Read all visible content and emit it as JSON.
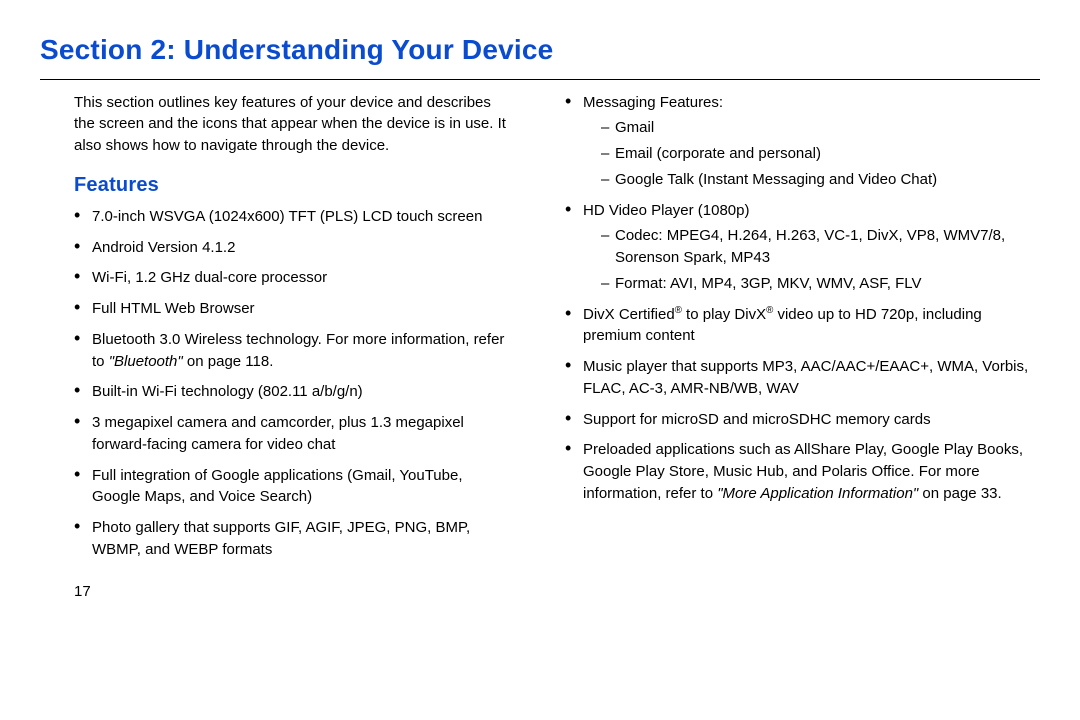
{
  "section_title": "Section 2: Understanding Your Device",
  "intro": "This section outlines key features of your device and describes the screen and the icons that appear when the device is in use. It also shows how to navigate through the device.",
  "features_heading": "Features",
  "left_bullets": {
    "b1": "7.0-inch WSVGA (1024x600) TFT (PLS) LCD touch screen",
    "b2": "Android Version 4.1.2",
    "b3": "Wi-Fi, 1.2 GHz dual-core processor",
    "b4": "Full HTML Web Browser",
    "b5_pre": "Bluetooth 3.0 Wireless technology. For more information, refer to ",
    "b5_link": "\"Bluetooth\"",
    "b5_post": " on page 118.",
    "b6": "Built-in Wi-Fi technology (802.11 a/b/g/n)",
    "b7": "3 megapixel camera and camcorder, plus 1.3 megapixel forward-facing camera for video chat",
    "b8": "Full integration of Google applications (Gmail, YouTube, Google Maps, and Voice Search)",
    "b9": "Photo gallery that supports GIF, AGIF, JPEG, PNG, BMP, WBMP, and WEBP formats"
  },
  "right_bullets": {
    "msg_title": "Messaging Features:",
    "msg_items": {
      "m1": "Gmail",
      "m2": "Email (corporate and personal)",
      "m3": "Google Talk (Instant Messaging and Video Chat)"
    },
    "hd_title": "HD Video Player (1080p)",
    "hd_items": {
      "h1": "Codec: MPEG4, H.264, H.263, VC-1, DivX, VP8, WMV7/8, Sorenson Spark, MP43",
      "h2": "Format: AVI, MP4, 3GP, MKV, WMV, ASF, FLV"
    },
    "divx_pre": "DivX Certified",
    "divx_mid": " to play DivX",
    "divx_post": " video up to HD 720p, including premium content",
    "reg": "®",
    "music": "Music player that supports MP3, AAC/AAC+/EAAC+, WMA, Vorbis, FLAC, AC-3, AMR-NB/WB, WAV",
    "sd": "Support for microSD and microSDHC memory cards",
    "preload_pre": "Preloaded applications such as AllShare Play, Google Play Books, Google Play Store, Music Hub, and Polaris Office. For more information, refer to ",
    "preload_link": "\"More Application Information\"",
    "preload_post": " on page 33."
  },
  "page_num": "17"
}
